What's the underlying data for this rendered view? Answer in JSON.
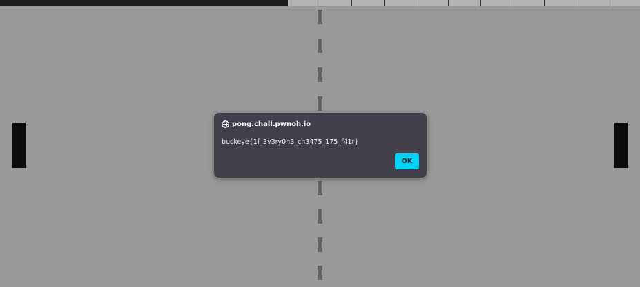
{
  "dialog": {
    "title": "pong.chall.pwnoh.io",
    "message": "buckeye{1f_3v3ry0n3_ch3475_175_f41r}",
    "ok_label": "OK",
    "icon": "globe-icon",
    "accent": "#00d3f6",
    "background": "#43404b"
  },
  "game": {
    "background": "#999999",
    "paddle_color": "#0b0b0b",
    "net_color": "#636363"
  }
}
